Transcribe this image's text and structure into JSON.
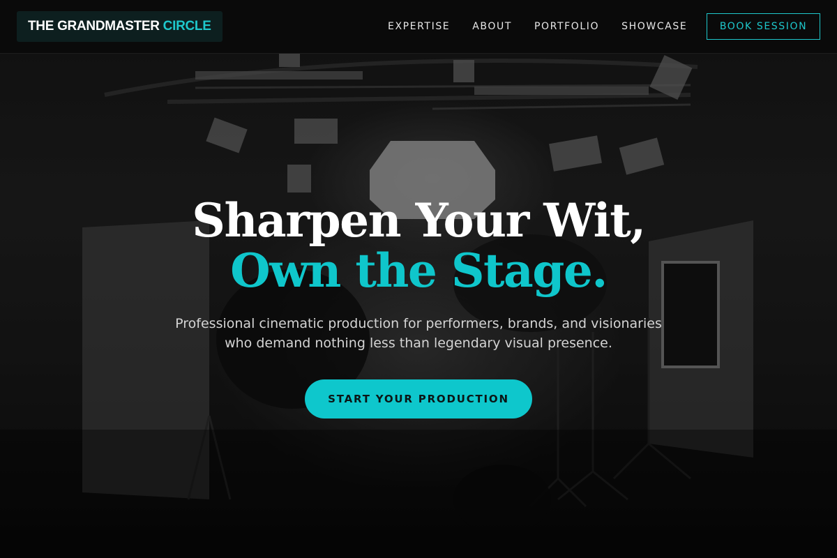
{
  "brand": {
    "name_main": "THE GRANDMASTER",
    "name_accent": "CIRCLE",
    "accent_color": "#1ec8cc"
  },
  "nav": {
    "links": [
      "EXPERTISE",
      "ABOUT",
      "PORTFOLIO",
      "SHOWCASE"
    ],
    "cta_label": "BOOK SESSION"
  },
  "hero": {
    "headline_line1": "Sharpen Your Wit,",
    "headline_line2": "Own the Stage.",
    "subtitle": "Professional cinematic production for performers, brands, and visionaries who demand nothing less than legendary visual presence.",
    "cta_label": "START YOUR PRODUCTION",
    "background_image": "film-studio-lighting-photo"
  }
}
